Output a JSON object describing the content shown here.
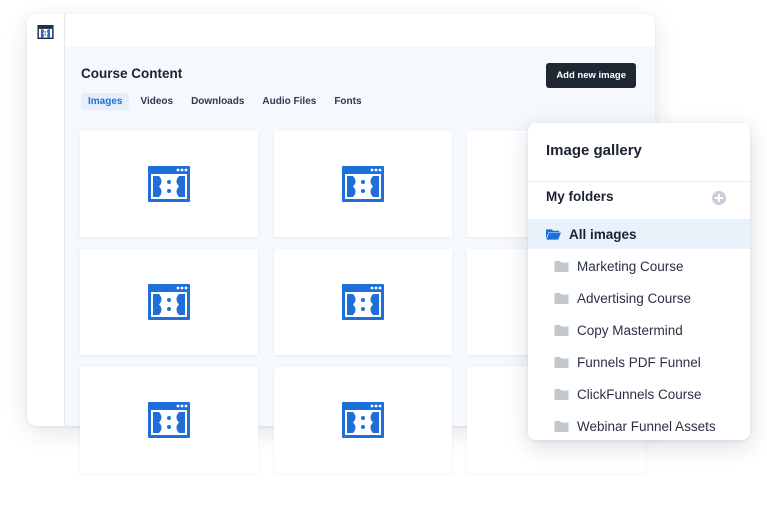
{
  "colors": {
    "accent": "#1e6fd9",
    "brand_blue": "#1e6fd9",
    "dark_button": "#1f2733",
    "content_bg": "#f5f8fc"
  },
  "main": {
    "title": "Course Content",
    "add_button": "Add new image",
    "tabs": [
      {
        "label": "Images",
        "active": true
      },
      {
        "label": "Videos",
        "active": false
      },
      {
        "label": "Downloads",
        "active": false
      },
      {
        "label": "Audio Files",
        "active": false
      },
      {
        "label": "Fonts",
        "active": false
      }
    ],
    "cards_icon": "clickfunnels-logo-icon"
  },
  "gallery": {
    "title": "Image gallery",
    "folders_heading": "My folders",
    "add_icon": "plus-circle-icon",
    "items": [
      {
        "label": "All images",
        "active": true,
        "icon": "folder-open-icon"
      },
      {
        "label": "Marketing Course",
        "active": false,
        "icon": "folder-icon"
      },
      {
        "label": "Advertising Course",
        "active": false,
        "icon": "folder-icon"
      },
      {
        "label": "Copy Mastermind",
        "active": false,
        "icon": "folder-icon"
      },
      {
        "label": "Funnels PDF Funnel",
        "active": false,
        "icon": "folder-icon"
      },
      {
        "label": "ClickFunnels Course",
        "active": false,
        "icon": "folder-icon"
      },
      {
        "label": "Webinar Funnel Assets",
        "active": false,
        "icon": "folder-icon"
      }
    ]
  }
}
